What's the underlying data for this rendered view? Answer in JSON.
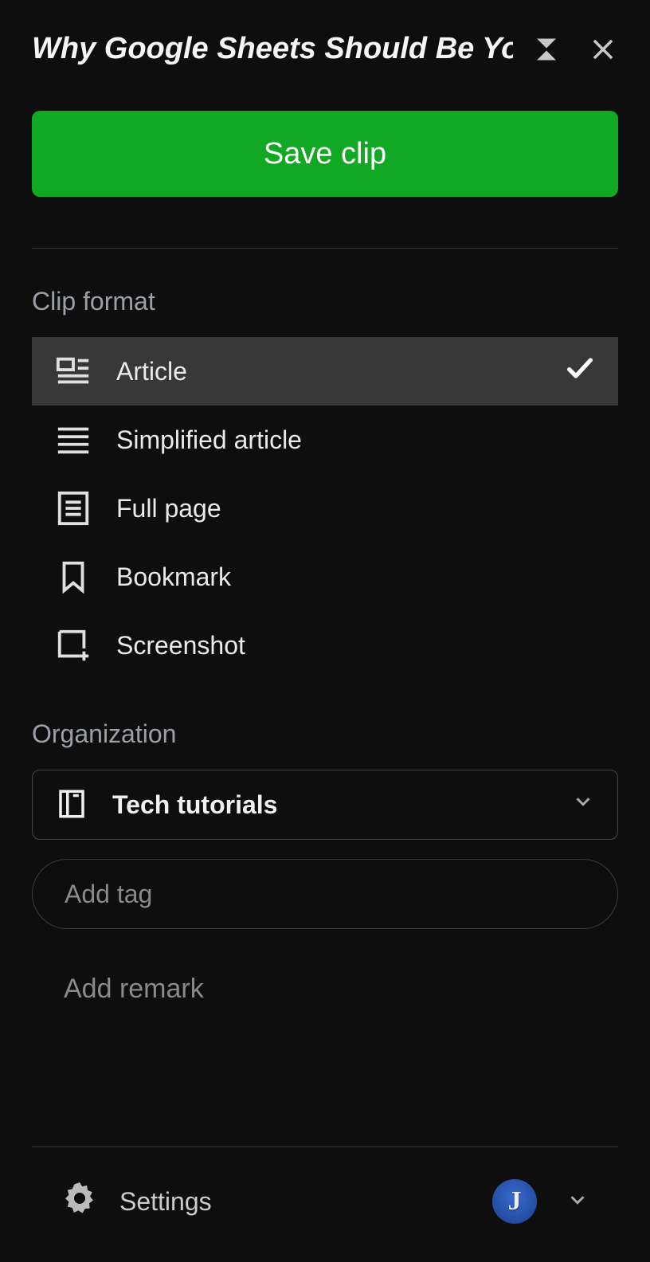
{
  "header": {
    "title": "Why Google Sheets Should Be Yo"
  },
  "save_button_label": "Save clip",
  "clip_format": {
    "section_label": "Clip format",
    "items": [
      {
        "label": "Article",
        "icon": "article-icon",
        "selected": true
      },
      {
        "label": "Simplified article",
        "icon": "simplified-article-icon",
        "selected": false
      },
      {
        "label": "Full page",
        "icon": "full-page-icon",
        "selected": false
      },
      {
        "label": "Bookmark",
        "icon": "bookmark-icon",
        "selected": false
      },
      {
        "label": "Screenshot",
        "icon": "screenshot-icon",
        "selected": false
      }
    ]
  },
  "organization": {
    "section_label": "Organization",
    "notebook": "Tech tutorials",
    "tag_placeholder": "Add tag"
  },
  "remark_button_label": "Add remark",
  "footer": {
    "settings_label": "Settings",
    "avatar_initial": "J"
  }
}
